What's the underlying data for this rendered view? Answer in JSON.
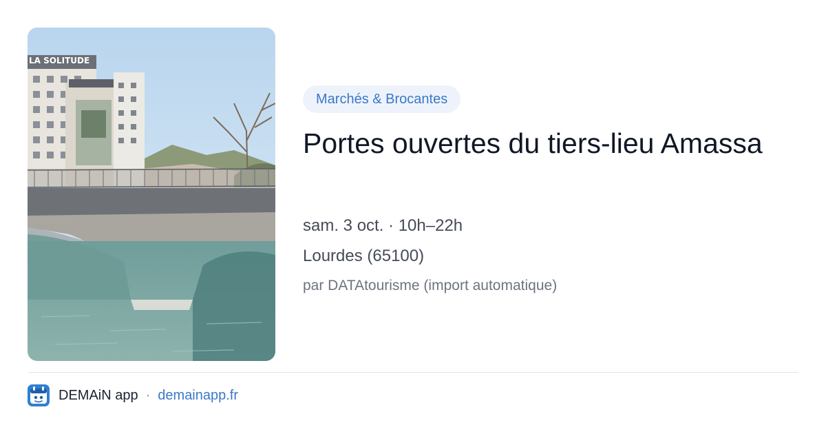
{
  "event": {
    "category": "Marchés & Brocantes",
    "title": "Portes ouvertes du tiers-lieu Amassa",
    "date": "sam. 3 oct. · 10h–22h",
    "location": "Lourdes (65100)",
    "source": "par DATAtourisme (import automatique)",
    "image": {
      "sign_text": "LA SOLITUDE",
      "icon": "photo-lourdes-bridge"
    }
  },
  "footer": {
    "app_name": "DEMAiN app",
    "separator": "·",
    "domain": "demainapp.fr",
    "icon": "demain-app-logo-icon"
  },
  "colors": {
    "accent": "#3b78c9",
    "tag_background": "#eef3fb",
    "title": "#101726",
    "body_text": "#454b57",
    "muted_text": "#6d7380",
    "divider": "#dfe3ea"
  }
}
